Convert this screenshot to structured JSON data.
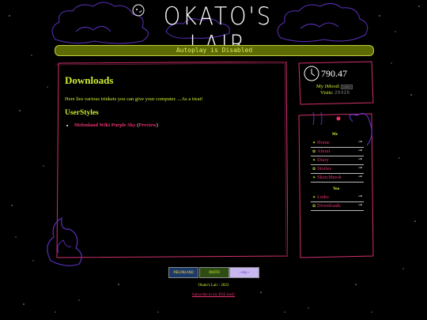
{
  "header": {
    "site_title": "OKATO'S LAIR",
    "autoplay_text": "Autoplay is Disabled"
  },
  "main": {
    "title": "Downloads",
    "intro": "Here lies various trinkets you can give your computer. ...As a treat!",
    "section_title": "UserStyles",
    "styles": [
      {
        "name": "Melonland Wiki Purple Sky",
        "preview_label": "Preview",
        "open_paren": "(",
        "close_paren": ")"
      }
    ]
  },
  "sidebar": {
    "hp_value": "790.47",
    "mood_label": "My iMood:",
    "mood_badge": "I AM S",
    "visits_label": "Visits:",
    "visit_count": "29426",
    "nav_head_me": "Me",
    "nav_head_you": "You",
    "nav_me": [
      {
        "label": "Home",
        "arrow": "⊸"
      },
      {
        "label": "About",
        "arrow": "⊸"
      },
      {
        "label": "Diary",
        "arrow": "⊸"
      },
      {
        "label": "Stories",
        "arrow": "⊸"
      },
      {
        "label": "Sketchbook",
        "arrow": "⊸"
      }
    ],
    "nav_you": [
      {
        "label": "Links",
        "arrow": "⊸"
      },
      {
        "label": "Downloads",
        "arrow": "⊸"
      }
    ]
  },
  "footer": {
    "buttons": [
      {
        "label": "MELONLAND"
      },
      {
        "label": "OKATO"
      },
      {
        "label": "~sky~"
      }
    ],
    "copyright": "Okato's Lair - 2023",
    "rss": "Subscribe to my RSS feed!"
  },
  "colors": {
    "accent_yellow": "#ccee33",
    "link_pink": "#e8336c",
    "frame_pink": "#d0306e",
    "cloud_purple": "#5a2fb8",
    "autoplay_bg": "#5d6b05"
  }
}
